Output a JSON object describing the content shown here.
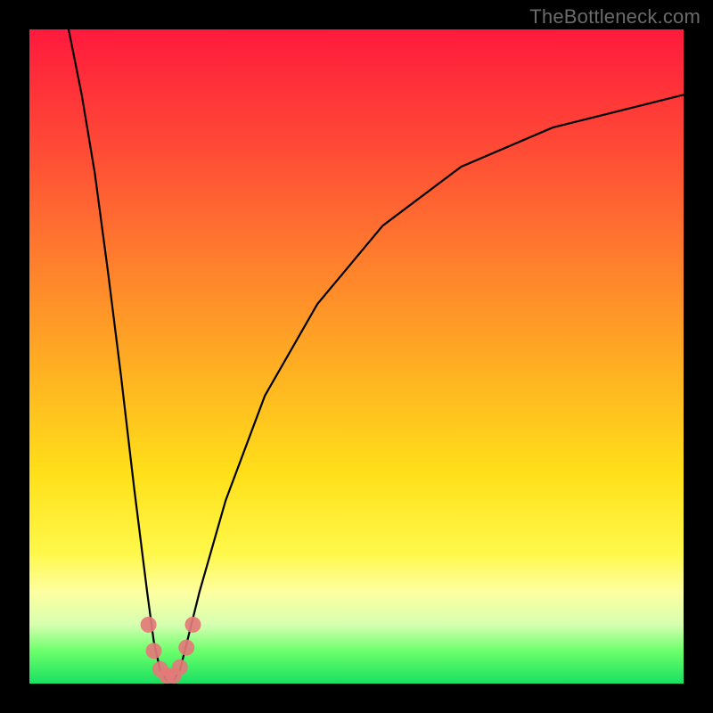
{
  "watermark": "TheBottleneck.com",
  "chart_data": {
    "type": "line",
    "title": "",
    "xlabel": "",
    "ylabel": "",
    "xlim": [
      0,
      100
    ],
    "ylim": [
      0,
      100
    ],
    "background_gradient_stops": [
      {
        "pos": 0,
        "color": "#ff1a3d"
      },
      {
        "pos": 18,
        "color": "#ff4a36"
      },
      {
        "pos": 34,
        "color": "#ff7a2e"
      },
      {
        "pos": 52,
        "color": "#ffb022"
      },
      {
        "pos": 68,
        "color": "#ffe019"
      },
      {
        "pos": 80,
        "color": "#fff84a"
      },
      {
        "pos": 86,
        "color": "#feffa0"
      },
      {
        "pos": 91,
        "color": "#d6ffb0"
      },
      {
        "pos": 95,
        "color": "#6cff6c"
      },
      {
        "pos": 100,
        "color": "#18e060"
      }
    ],
    "series": [
      {
        "name": "bottleneck-curve",
        "stroke": "#000000",
        "points": [
          {
            "x": 6.0,
            "y": 100.0
          },
          {
            "x": 8.0,
            "y": 90.0
          },
          {
            "x": 10.0,
            "y": 78.0
          },
          {
            "x": 12.0,
            "y": 63.0
          },
          {
            "x": 14.0,
            "y": 47.0
          },
          {
            "x": 16.0,
            "y": 30.0
          },
          {
            "x": 18.0,
            "y": 14.0
          },
          {
            "x": 19.0,
            "y": 6.5
          },
          {
            "x": 20.0,
            "y": 2.0
          },
          {
            "x": 21.0,
            "y": 0.5
          },
          {
            "x": 22.0,
            "y": 0.5
          },
          {
            "x": 23.0,
            "y": 2.0
          },
          {
            "x": 24.0,
            "y": 6.0
          },
          {
            "x": 26.0,
            "y": 14.0
          },
          {
            "x": 30.0,
            "y": 28.0
          },
          {
            "x": 36.0,
            "y": 44.0
          },
          {
            "x": 44.0,
            "y": 58.0
          },
          {
            "x": 54.0,
            "y": 70.0
          },
          {
            "x": 66.0,
            "y": 79.0
          },
          {
            "x": 80.0,
            "y": 85.0
          },
          {
            "x": 100.0,
            "y": 90.0
          }
        ]
      },
      {
        "name": "highlight-markers",
        "stroke": "#e37a7a",
        "marker_radius_px": 9,
        "points": [
          {
            "x": 18.2,
            "y": 9.0
          },
          {
            "x": 19.0,
            "y": 5.0
          },
          {
            "x": 20.0,
            "y": 2.2
          },
          {
            "x": 21.0,
            "y": 1.2
          },
          {
            "x": 22.0,
            "y": 1.2
          },
          {
            "x": 23.0,
            "y": 2.5
          },
          {
            "x": 24.0,
            "y": 5.5
          },
          {
            "x": 25.0,
            "y": 9.0
          }
        ]
      }
    ]
  }
}
